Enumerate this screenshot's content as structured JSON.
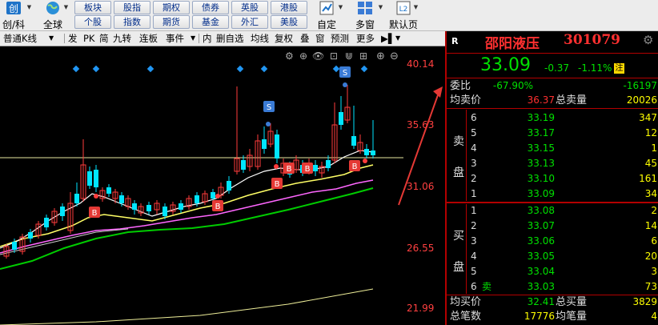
{
  "toolbar": {
    "chuangke_label": "创/科",
    "quanqiu_label": "全球",
    "grid_buttons": [
      [
        "板块",
        "股指",
        "期权",
        "债券",
        "英股",
        "港股"
      ],
      [
        "个股",
        "指数",
        "期货",
        "基金",
        "外汇",
        "美股"
      ]
    ],
    "zixuan_label": "自定",
    "duochuang_label": "多窗",
    "default_label": "默认页"
  },
  "tabs": [
    "普通K线",
    "发",
    "PK",
    "简",
    "九转",
    "连板",
    "事件",
    "内",
    "删自选",
    "均线",
    "复权",
    "叠",
    "窗",
    "预测",
    "更多"
  ],
  "chart": {
    "y_ticks": [
      "40.14",
      "35.63",
      "31.06",
      "26.55",
      "21.99"
    ],
    "marker_b": "B",
    "marker_s": "S"
  },
  "quote": {
    "flag": "R",
    "name": "邵阳液压",
    "code": "301079",
    "price": "33.09",
    "change": "-0.37",
    "pct": "-1.11%",
    "badge": "注",
    "weibi_label": "委比",
    "weibi_pct": "-67.90%",
    "weibi_val": "-16197",
    "avg_sell_label": "均卖价",
    "avg_sell": "36.37",
    "total_sell_label": "总卖量",
    "total_sell": "20026",
    "sell_side_label": [
      "卖",
      "盘"
    ],
    "asks": [
      {
        "level": "6",
        "price": "33.19",
        "vol": "347"
      },
      {
        "level": "5",
        "price": "33.17",
        "vol": "12"
      },
      {
        "level": "4",
        "price": "33.15",
        "vol": "1"
      },
      {
        "level": "3",
        "price": "33.13",
        "vol": "45"
      },
      {
        "level": "2",
        "price": "33.10",
        "vol": "161"
      },
      {
        "level": "1",
        "price": "33.09",
        "vol": "34"
      }
    ],
    "buy_side_label": [
      "买",
      "盘"
    ],
    "bids": [
      {
        "level": "1",
        "price": "33.08",
        "vol": "2"
      },
      {
        "level": "2",
        "price": "33.07",
        "vol": "14"
      },
      {
        "level": "3",
        "price": "33.06",
        "vol": "6"
      },
      {
        "level": "4",
        "price": "33.05",
        "vol": "20"
      },
      {
        "level": "5",
        "price": "33.04",
        "vol": "3"
      },
      {
        "level": "6",
        "price": "33.03",
        "vol": "73"
      }
    ],
    "bid6_tag": "卖",
    "avg_buy_label": "均买价",
    "avg_buy": "32.41",
    "total_buy_label": "总买量",
    "total_buy": "3829",
    "trades_label": "总笔数",
    "trades": "17776",
    "avg_vol_label": "均笔量",
    "avg_vol": "4"
  },
  "colors": {
    "up": "#ff3c3c",
    "down": "#00e5ff",
    "ma5": "#ffffff",
    "ma10": "#ffff66",
    "ma20": "#ff66ff",
    "ma60": "#00cc00",
    "green": "#00e000",
    "yellow": "#ffff00"
  }
}
